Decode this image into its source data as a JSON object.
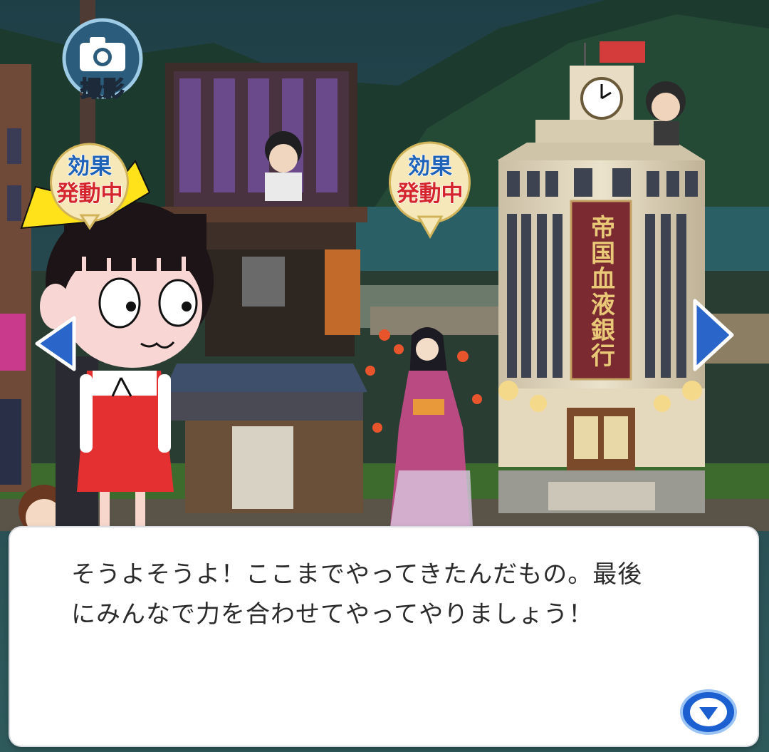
{
  "camera_button": {
    "label": "撮影",
    "icon": "camera-icon"
  },
  "effect_badges": [
    {
      "top": "効果",
      "bottom": "発動中"
    },
    {
      "top": "効果",
      "bottom": "発動中"
    }
  ],
  "bank_sign": "帝国血液銀行",
  "dialog": {
    "line1": "そうよそうよ！ここまでやってきたんだもの。最後",
    "line2": "にみんなで力を合わせてやってやりましょう！"
  },
  "nav": {
    "left_icon": "left-arrow-icon",
    "right_icon": "right-arrow-icon",
    "next_icon": "chevron-down-icon"
  },
  "colors": {
    "badge_top": "#1e63b8",
    "badge_bottom": "#d4262c",
    "arrow": "#2a66c9",
    "dialog_bg": "#ffffff"
  }
}
